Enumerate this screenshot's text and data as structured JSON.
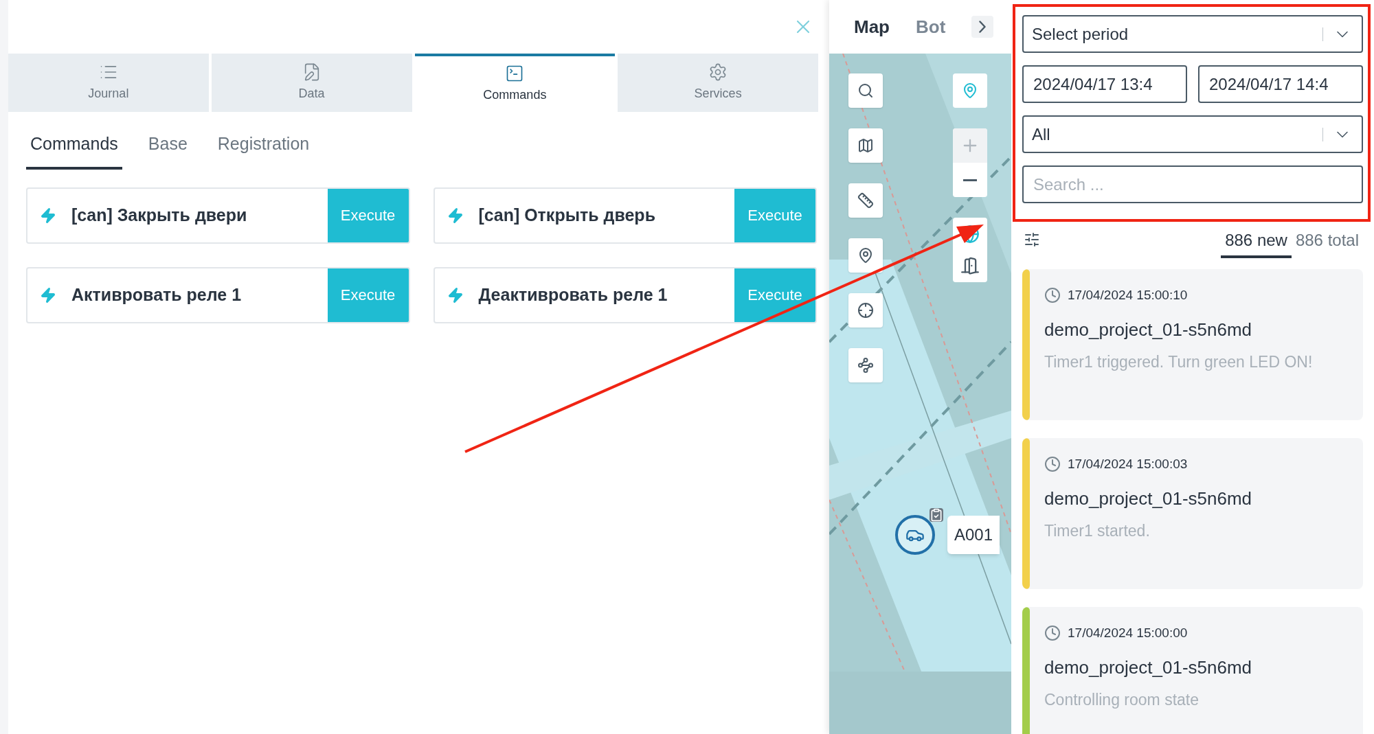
{
  "tabs": [
    {
      "label": "Journal",
      "kind": "journal",
      "selected": false
    },
    {
      "label": "Data",
      "kind": "data",
      "selected": false
    },
    {
      "label": "Commands",
      "kind": "commands",
      "selected": true
    },
    {
      "label": "Services",
      "kind": "services",
      "selected": false
    }
  ],
  "subtabs": [
    {
      "label": "Commands",
      "selected": true
    },
    {
      "label": "Base",
      "selected": false
    },
    {
      "label": "Registration",
      "selected": false
    }
  ],
  "commands": [
    {
      "name": "[can] Закрыть двери",
      "action": "Execute"
    },
    {
      "name": "[can] Открыть дверь",
      "action": "Execute"
    },
    {
      "name": "Активровать реле 1",
      "action": "Execute"
    },
    {
      "name": "Деактивровать реле 1",
      "action": "Execute"
    }
  ],
  "map_tabs": [
    {
      "label": "Map",
      "selected": true
    },
    {
      "label": "Bot",
      "selected": false
    }
  ],
  "marker": {
    "label": "A001"
  },
  "filters": {
    "period": "Select period",
    "from": "2024/04/17 13:4",
    "to": "2024/04/17 14:4",
    "type": "All",
    "search_placeholder": "Search ..."
  },
  "counters": [
    {
      "label": "886 new",
      "selected": true
    },
    {
      "label": "886 total",
      "selected": false
    }
  ],
  "events": [
    {
      "time": "17/04/2024 15:00:10",
      "device": "demo_project_01-s5n6md",
      "message": "Timer1 triggered. Turn green LED ON!",
      "color": "#f2d04b"
    },
    {
      "time": "17/04/2024 15:00:03",
      "device": "demo_project_01-s5n6md",
      "message": "Timer1 started.",
      "color": "#f2d04b"
    },
    {
      "time": "17/04/2024 15:00:00",
      "device": "demo_project_01-s5n6md",
      "message": "Controlling room state",
      "color": "#a3cd4a"
    }
  ]
}
